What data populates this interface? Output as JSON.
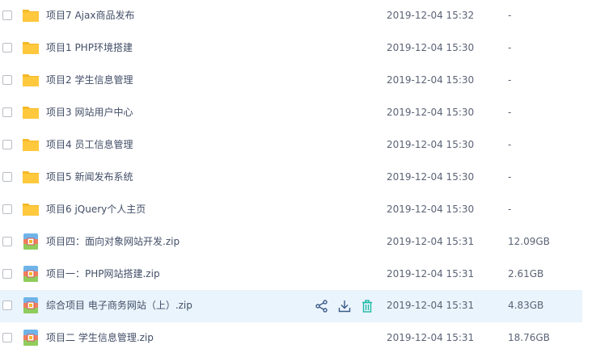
{
  "files": [
    {
      "name": "项目7 Ajax商品发布",
      "date": "2019-12-04 15:32",
      "size": "-",
      "type": "folder-icon"
    },
    {
      "name": "项目1 PHP环境搭建",
      "date": "2019-12-04 15:30",
      "size": "-",
      "type": "folder-icon"
    },
    {
      "name": "项目2 学生信息管理",
      "date": "2019-12-04 15:30",
      "size": "-",
      "type": "folder-icon"
    },
    {
      "name": "项目3 网站用户中心",
      "date": "2019-12-04 15:30",
      "size": "-",
      "type": "folder-icon"
    },
    {
      "name": "项目4 员工信息管理",
      "date": "2019-12-04 15:30",
      "size": "-",
      "type": "folder-icon"
    },
    {
      "name": "项目5 新闻发布系统",
      "date": "2019-12-04 15:30",
      "size": "-",
      "type": "folder-icon"
    },
    {
      "name": "项目6 jQuery个人主页",
      "date": "2019-12-04 15:30",
      "size": "-",
      "type": "folder-icon"
    },
    {
      "name": "项目四：面向对象网站开发.zip",
      "date": "2019-12-04 15:31",
      "size": "12.09GB",
      "type": "zip-archive-icon"
    },
    {
      "name": "项目一：PHP网站搭建.zip",
      "date": "2019-12-04 15:31",
      "size": "2.61GB",
      "type": "zip-archive-icon"
    },
    {
      "name": "综合项目 电子商务网站（上）.zip",
      "date": "2019-12-04 15:31",
      "size": "4.83GB",
      "type": "zip-archive-icon"
    },
    {
      "name": "项目二 学生信息管理.zip",
      "date": "2019-12-04 15:31",
      "size": "18.76GB",
      "type": "zip-archive-icon"
    }
  ],
  "hovered_row": 9,
  "row_actions": [
    "share-icon",
    "download-icon",
    "delete-icon"
  ],
  "colors": {
    "folder": "#ffc83d",
    "hover_background": "#eaf4fc",
    "action_icon": "#3b7ddd",
    "delete_icon": "#1fb9a8"
  }
}
